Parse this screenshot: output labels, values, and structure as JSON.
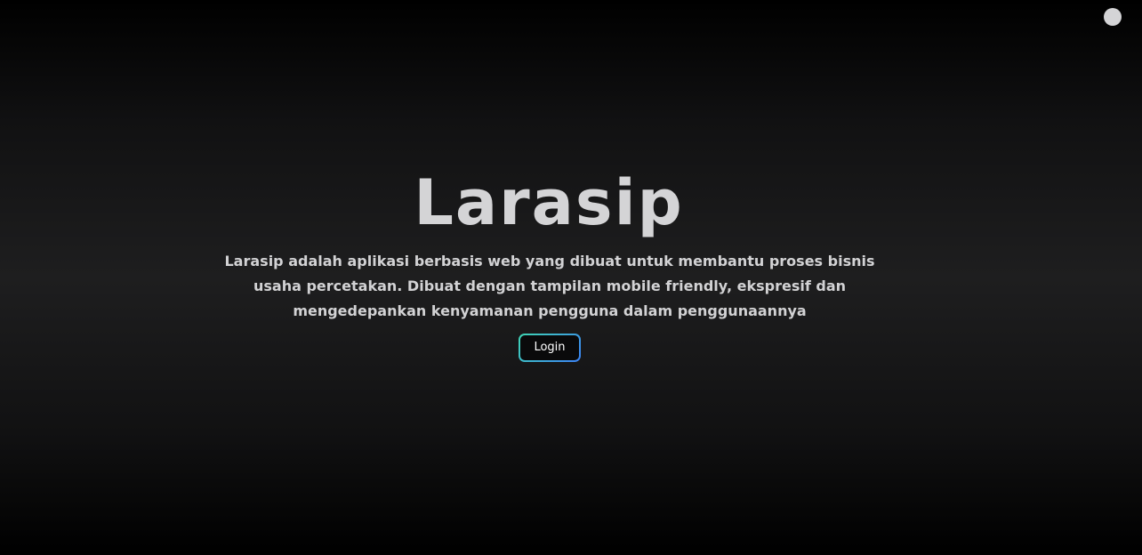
{
  "hero": {
    "title": "Larasip",
    "description": "Larasip adalah aplikasi berbasis web yang dibuat untuk membantu proses bisnis usaha percetakan. Dibuat dengan tampilan mobile friendly, ekspresif dan mengedepankan kenyamanan pengguna dalam penggunaannya",
    "login_label": "Login"
  },
  "colors": {
    "background": "#1e1e1f",
    "text": "#d4d4d6",
    "button_gradient_start": "#3fd6b2",
    "button_gradient_end": "#3b82f6"
  },
  "icons": {
    "theme_toggle": "circle-toggle-icon"
  }
}
